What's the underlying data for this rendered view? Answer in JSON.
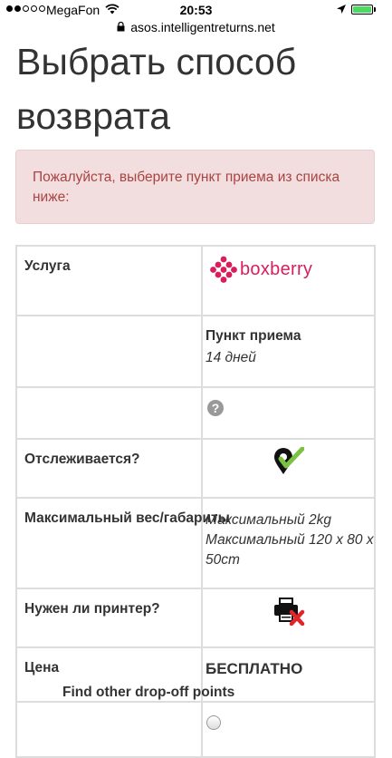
{
  "status_bar": {
    "carrier": "MegaFon",
    "time": "20:53",
    "battery_color": "#4cd964"
  },
  "browser": {
    "url": "asos.intelligentreturns.net"
  },
  "page": {
    "title": "Выбрать способ возврата",
    "alert_message": "Пожалуйста, выберите пункт приема из списка ниже:"
  },
  "table": {
    "service_label": "Услуга",
    "service_logo_text": "boxberry",
    "pickup_title": "Пункт приема",
    "pickup_days": "14 дней",
    "tracked_label": "Отслеживается?",
    "max_label": "Максимальный вес/габариты",
    "max_weight": "Максимальный 2kg",
    "max_dims": "Максимальный 120 x 80 x 50cm",
    "printer_label": "Нужен ли принтер?",
    "price_label": "Цена",
    "price_value": "БЕСПЛАТНО",
    "help_glyph": "?"
  },
  "footer": {
    "find_other_link": "Find other drop-off points"
  },
  "colors": {
    "alert_bg": "#f2dede",
    "alert_text": "#a94442",
    "brand_pink": "#d81f5b",
    "tracked_green": "#7cc242",
    "printer_red": "#e0252b"
  },
  "icons": {
    "tracked": "map-pin-check-icon",
    "printer": "printer-not-required-icon",
    "help": "question-circle-icon"
  }
}
